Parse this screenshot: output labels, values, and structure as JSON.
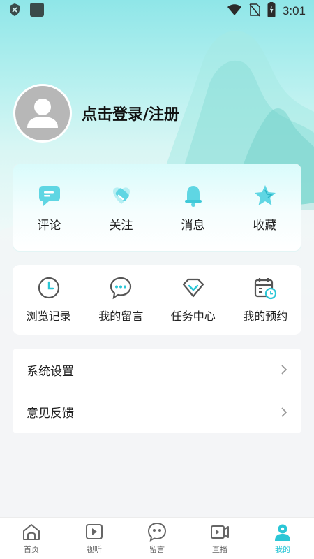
{
  "status_bar": {
    "time": "3:01"
  },
  "profile": {
    "login_label": "点击登录/注册"
  },
  "social": [
    {
      "label": "评论",
      "icon": "comment-icon"
    },
    {
      "label": "关注",
      "icon": "like-tag-icon"
    },
    {
      "label": "消息",
      "icon": "bell-icon"
    },
    {
      "label": "收藏",
      "icon": "star-icon"
    }
  ],
  "tools": [
    {
      "label": "浏览记录",
      "icon": "clock-icon"
    },
    {
      "label": "我的留言",
      "icon": "chat-bubble-icon"
    },
    {
      "label": "任务中心",
      "icon": "task-diamond-icon"
    },
    {
      "label": "我的预约",
      "icon": "calendar-clock-icon"
    }
  ],
  "settings": [
    {
      "label": "系统设置"
    },
    {
      "label": "意见反馈"
    }
  ],
  "nav": [
    {
      "label": "首页",
      "icon": "home-icon"
    },
    {
      "label": "视听",
      "icon": "play-icon"
    },
    {
      "label": "留言",
      "icon": "message-face-icon"
    },
    {
      "label": "直播",
      "icon": "video-camera-icon"
    },
    {
      "label": "我的",
      "icon": "user-icon",
      "active": true
    }
  ],
  "colors": {
    "accent": "#2bc6d6",
    "accent_light": "#6ee0ea",
    "icon_gray": "#555555"
  }
}
